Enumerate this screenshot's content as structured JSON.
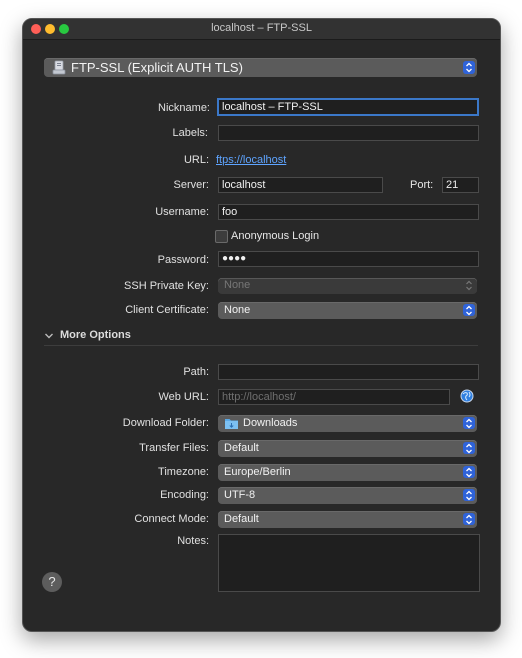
{
  "window": {
    "title": "localhost – FTP-SSL"
  },
  "protocol": {
    "label": "FTP-SSL (Explicit AUTH TLS)",
    "icon": "ftp-drive-icon"
  },
  "form": {
    "nickname": {
      "label": "Nickname:",
      "value": "localhost – FTP-SSL"
    },
    "labels": {
      "label": "Labels:",
      "value": ""
    },
    "url": {
      "label": "URL:",
      "value": "ftps://localhost"
    },
    "server": {
      "label": "Server:",
      "value": "localhost"
    },
    "port": {
      "label": "Port:",
      "value": "21"
    },
    "username": {
      "label": "Username:",
      "value": "foo"
    },
    "anonymous": {
      "label": "Anonymous Login",
      "checked": false
    },
    "password": {
      "label": "Password:",
      "value": "●●●●"
    },
    "ssh_key": {
      "label": "SSH Private Key:",
      "value": "None"
    },
    "client_cert": {
      "label": "Client Certificate:",
      "value": "None"
    }
  },
  "more_options": {
    "header": "More Options",
    "path": {
      "label": "Path:",
      "value": ""
    },
    "web_url": {
      "label": "Web URL:",
      "placeholder": "http://localhost/"
    },
    "download_folder": {
      "label": "Download Folder:",
      "value": "Downloads"
    },
    "transfer_files": {
      "label": "Transfer Files:",
      "value": "Default"
    },
    "timezone": {
      "label": "Timezone:",
      "value": "Europe/Berlin"
    },
    "encoding": {
      "label": "Encoding:",
      "value": "UTF-8"
    },
    "connect_mode": {
      "label": "Connect Mode:",
      "value": "Default"
    },
    "notes": {
      "label": "Notes:",
      "value": ""
    }
  },
  "help": {
    "label": "?"
  },
  "colors": {
    "accent": "#2f63d9",
    "link": "#5ea4ff",
    "window_bg": "#282828",
    "focus_ring": "#3b78c9"
  }
}
